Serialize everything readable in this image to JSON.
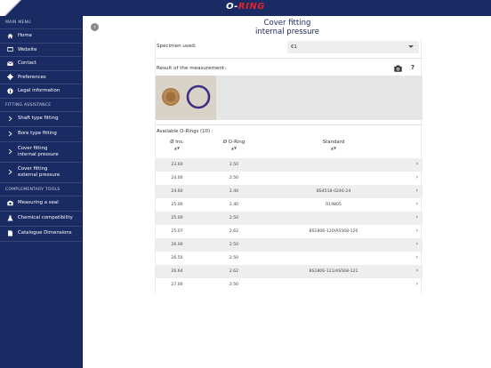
{
  "topbar": {
    "brand_left": "O-",
    "brand_right": "RING"
  },
  "sidebar": {
    "sections": [
      {
        "title": "MAIN MENU"
      },
      {
        "title": "FITTING ASSISTANCE"
      },
      {
        "title": "COMPLEMENTARY TOOLS"
      }
    ],
    "main_items": [
      {
        "label": "Home",
        "icon": "home-icon"
      },
      {
        "label": "Website",
        "icon": "globe-icon"
      },
      {
        "label": "Contact",
        "icon": "envelope-icon"
      },
      {
        "label": "Preferences",
        "icon": "gear-icon"
      },
      {
        "label": "Legal information",
        "icon": "info-icon"
      }
    ],
    "fitting_items": [
      {
        "label": "Shaft type fitting",
        "icon": "chevron-right-icon"
      },
      {
        "label": "Bore type fitting",
        "icon": "chevron-right-icon"
      },
      {
        "label": "Cover fitting\ninternal pressure",
        "icon": "chevron-right-icon"
      },
      {
        "label": "Cover fitting\nexternal pressure",
        "icon": "chevron-right-icon"
      }
    ],
    "tool_items": [
      {
        "label": "Measuring a seal",
        "icon": "camera-icon"
      },
      {
        "label": "Chemical compatibility",
        "icon": "flask-icon"
      },
      {
        "label": "Catalogue Dimensions",
        "icon": "document-icon"
      }
    ]
  },
  "main": {
    "title_line1": "Cover fitting",
    "title_line2": "internal pressure",
    "specimen_label": "Specimen used:",
    "specimen_value": "€1",
    "result_label": "Result of the measurement:",
    "help_label": "?",
    "available_label": "Available O-Rings (10) :",
    "columns": [
      "Ø Ins.",
      "Ø O-Ring",
      "Standard"
    ],
    "sort_glyph": "▲▼",
    "row_chevron": "›",
    "rows": [
      {
        "ins": "23.60",
        "oring": "2.50",
        "standard": ""
      },
      {
        "ins": "24.00",
        "oring": "2.50",
        "standard": ""
      },
      {
        "ins": "24.60",
        "oring": "2.40",
        "standard": "BS4518-0246-24"
      },
      {
        "ins": "25.00",
        "oring": "2.40",
        "standard": "R19805"
      },
      {
        "ins": "25.00",
        "oring": "2.50",
        "standard": ""
      },
      {
        "ins": "25.07",
        "oring": "2.62",
        "standard": "BS1806-120/AS568-120"
      },
      {
        "ins": "26.00",
        "oring": "2.50",
        "standard": ""
      },
      {
        "ins": "26.50",
        "oring": "2.50",
        "standard": ""
      },
      {
        "ins": "26.64",
        "oring": "2.62",
        "standard": "BS1806-121/AS568-121"
      },
      {
        "ins": "27.00",
        "oring": "2.50",
        "standard": ""
      }
    ]
  },
  "colors": {
    "navy": "#1a2a63",
    "accent_red": "#e3232c",
    "row_alt": "#eeeeee"
  }
}
